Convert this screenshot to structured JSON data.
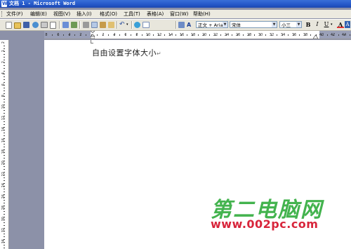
{
  "window": {
    "title": "文档 1 - Microsoft Word"
  },
  "menu": [
    {
      "label": "文件(F)"
    },
    {
      "label": "编辑(E)"
    },
    {
      "label": "视图(V)"
    },
    {
      "label": "插入(I)"
    },
    {
      "label": "格式(O)"
    },
    {
      "label": "工具(T)"
    },
    {
      "label": "表格(A)"
    },
    {
      "label": "窗口(W)"
    },
    {
      "label": "帮助(H)"
    }
  ],
  "toolbar": {
    "style_value": "正文 + Aria",
    "font_value": "宋体",
    "size_value": "小三",
    "bold_label": "B",
    "italic_label": "I",
    "underline_label": "U",
    "font_color_label": "A"
  },
  "ruler": {
    "h_labels": [
      "8",
      "6",
      "4",
      "2",
      "2",
      "4",
      "6",
      "8",
      "10",
      "12",
      "14",
      "16",
      "18",
      "20",
      "22",
      "24",
      "26",
      "28",
      "30",
      "32",
      "34",
      "36",
      "38",
      "40",
      "42",
      "44"
    ],
    "v_labels": [
      "2",
      "1",
      "2",
      "4",
      "6",
      "8",
      "10",
      "12",
      "14",
      "16",
      "18",
      "20",
      "22",
      "24",
      "26",
      "28",
      "30",
      "32",
      "34"
    ]
  },
  "document": {
    "text": "自由设置字体大小",
    "paragraph_mark": "↵"
  },
  "watermark": {
    "brand": "第二电脑网",
    "url": "www.002pc.com"
  },
  "colors": {
    "titlebar": "#2457c8",
    "watermark_brand": "#43b34e",
    "watermark_url": "#d8253b"
  }
}
